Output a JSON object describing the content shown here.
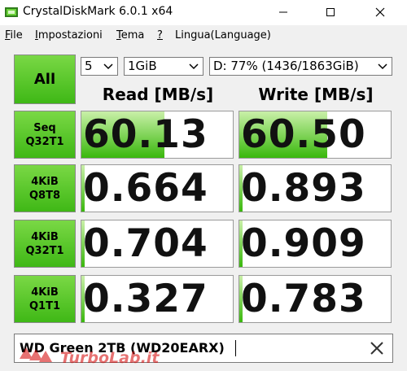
{
  "window": {
    "title": "CrystalDiskMark 6.0.1 x64",
    "minimize_icon": "minimize-icon",
    "maximize_icon": "maximize-icon",
    "close_icon": "close-icon"
  },
  "menu": [
    {
      "underline": "F",
      "rest": "ile"
    },
    {
      "underline": "I",
      "rest": "mpostazioni"
    },
    {
      "underline": "T",
      "rest": "ema"
    },
    {
      "underline": "?",
      "rest": ""
    },
    {
      "underline": "",
      "rest": "Lingua(Language)"
    }
  ],
  "controls": {
    "all_label": "All",
    "test_count": "5",
    "test_size": "1GiB",
    "drive": "D: 77% (1436/1863GiB)"
  },
  "headers": {
    "read": "Read [MB/s]",
    "write": "Write [MB/s]"
  },
  "tests": [
    {
      "line1": "Seq",
      "line2": "Q32T1",
      "read": "60.13",
      "write": "60.50",
      "read_fill": 0.55,
      "write_fill": 0.58
    },
    {
      "line1": "4KiB",
      "line2": "Q8T8",
      "read": "0.664",
      "write": "0.893",
      "read_fill": 0.02,
      "write_fill": 0.02
    },
    {
      "line1": "4KiB",
      "line2": "Q32T1",
      "read": "0.704",
      "write": "0.909",
      "read_fill": 0.02,
      "write_fill": 0.02
    },
    {
      "line1": "4KiB",
      "line2": "Q1T1",
      "read": "0.327",
      "write": "0.783",
      "read_fill": 0.02,
      "write_fill": 0.02
    }
  ],
  "comment": {
    "text": "WD Green 2TB (WD20EARX)",
    "clear_icon": "close-icon"
  },
  "watermark": {
    "text": "TurboLab.it"
  },
  "colors": {
    "accent_green": "#3fb816",
    "bar_light": "#c9f0a8",
    "bar_dark": "#39b80c"
  }
}
